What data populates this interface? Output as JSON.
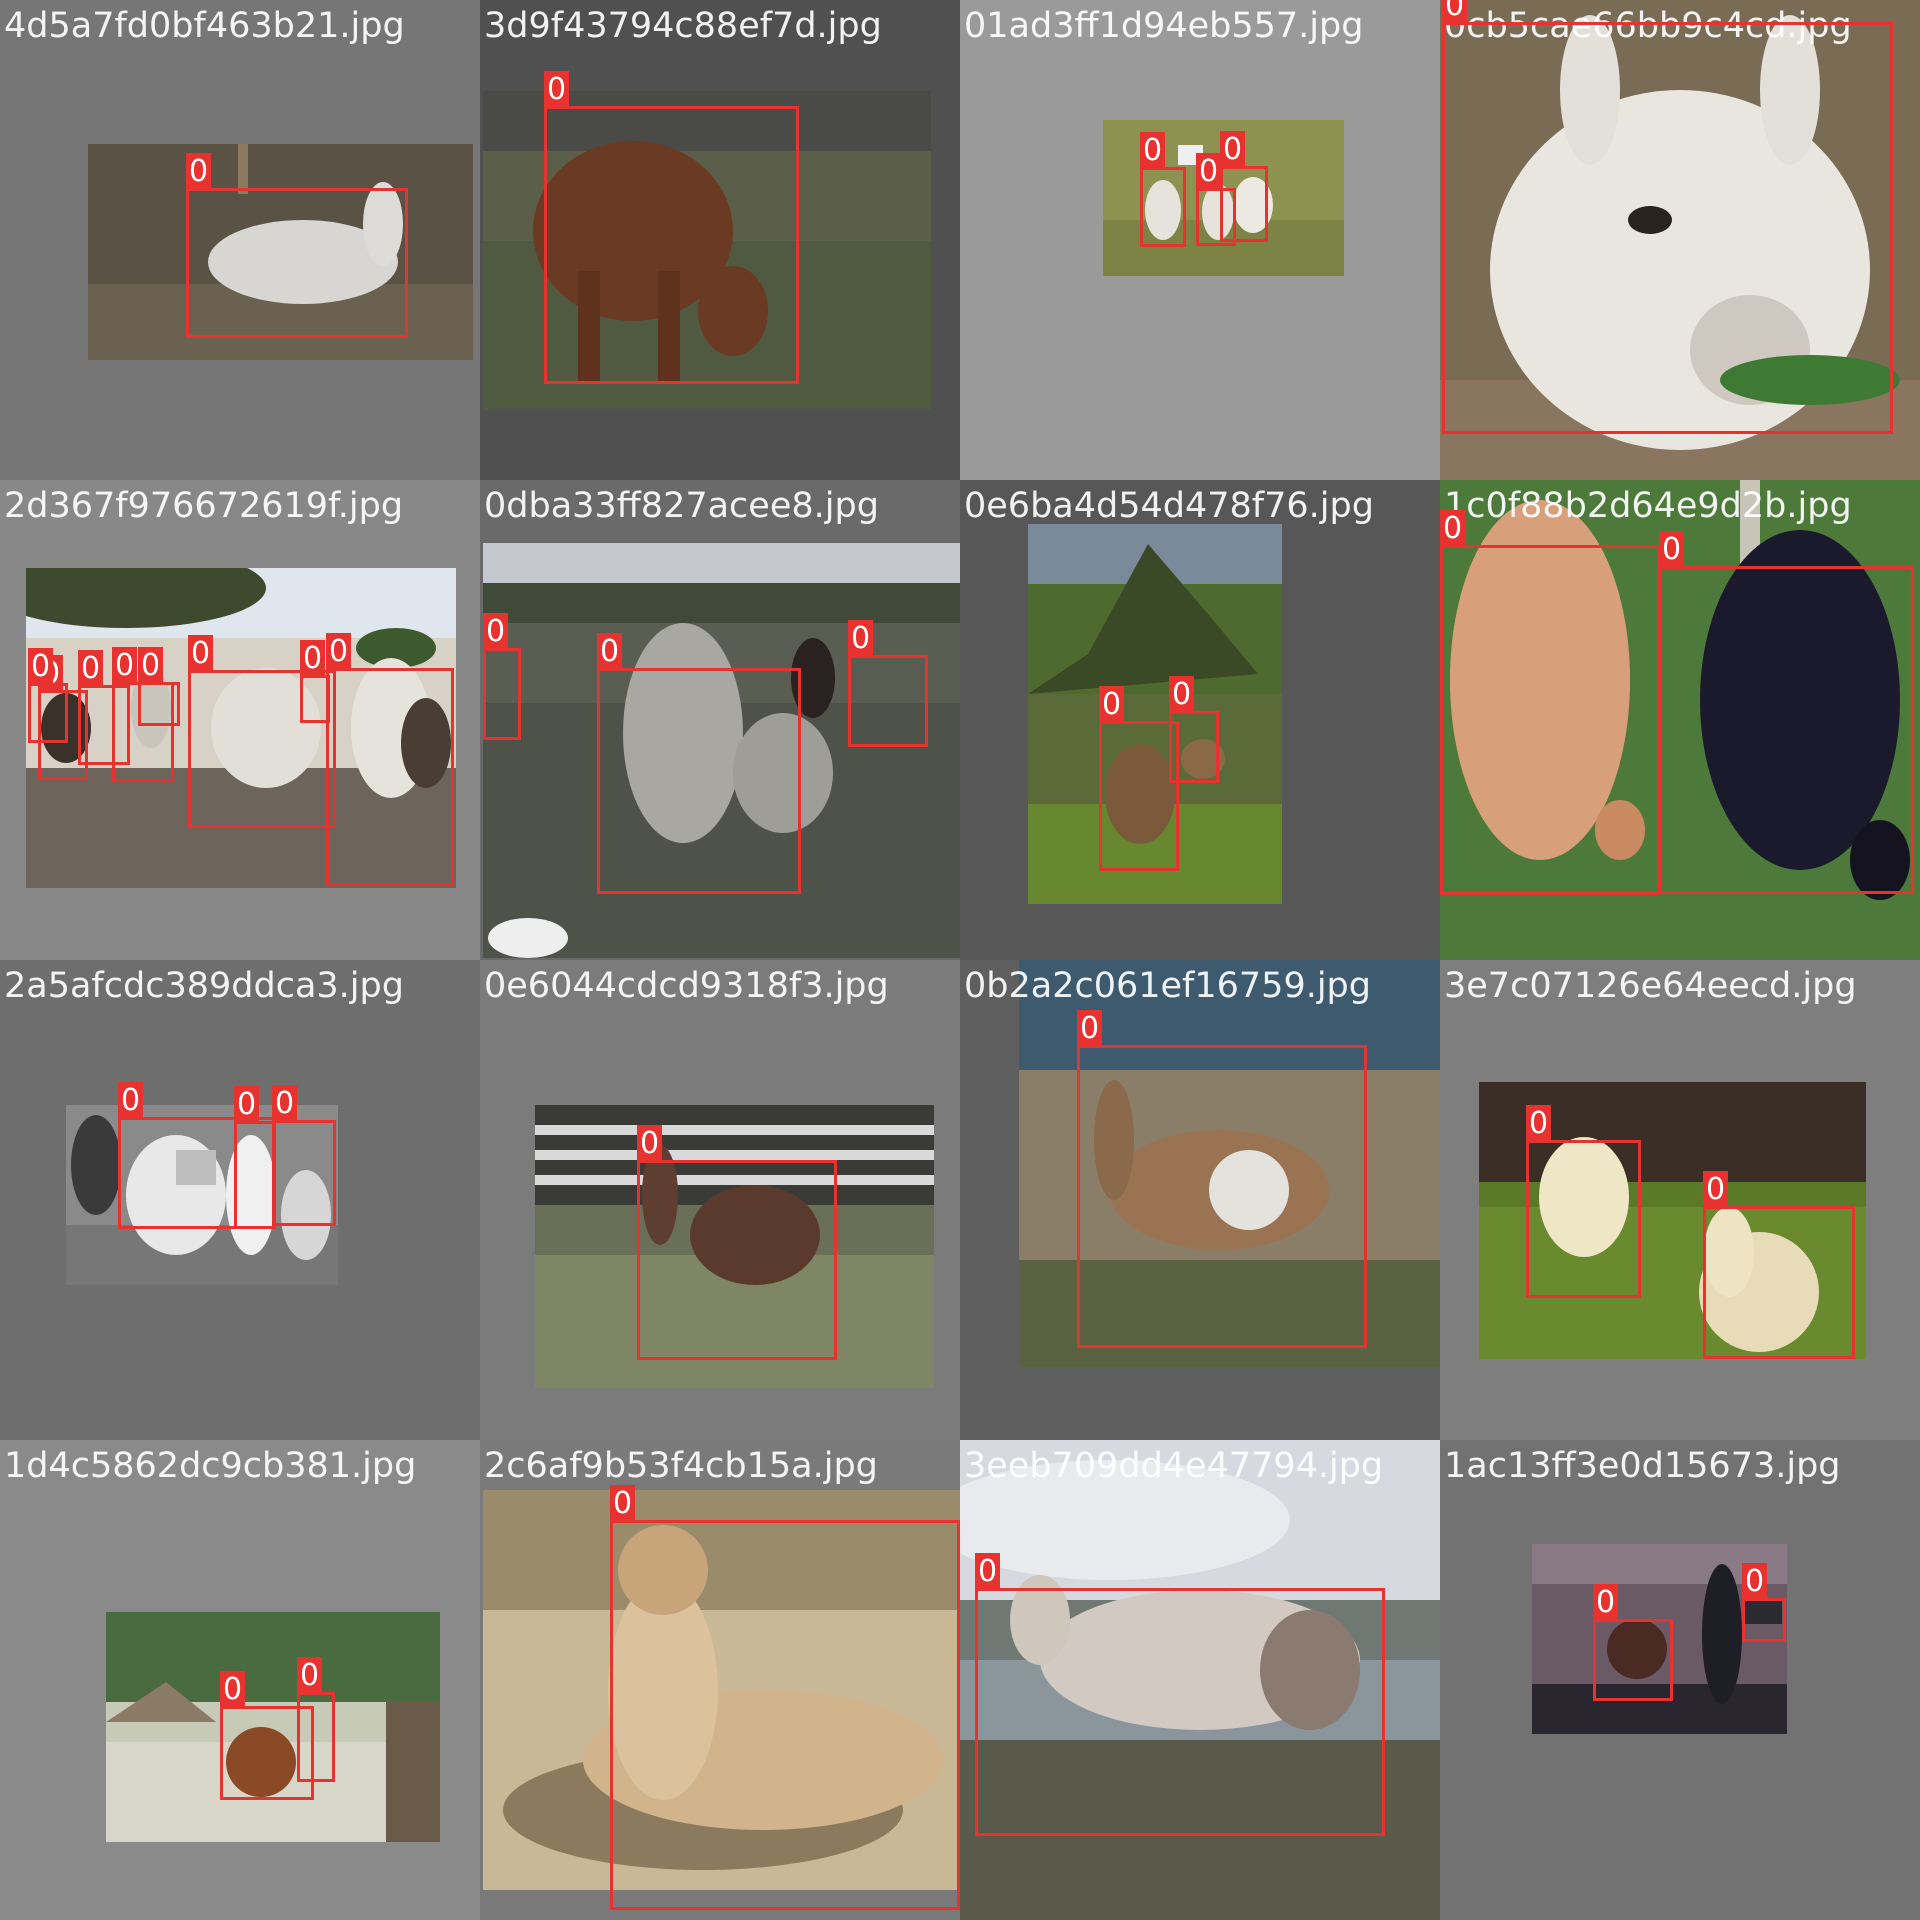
{
  "colors": {
    "box": "#e8322f",
    "label_text": "#ffffff"
  },
  "box_label": "0",
  "tiles": [
    {
      "filename": "4d5a7fd0bf463b21.jpg",
      "bg": "#767676"
    },
    {
      "filename": "3d9f43794c88ef7d.jpg",
      "bg": "#505050"
    },
    {
      "filename": "01ad3ff1d94eb557.jpg",
      "bg": "#9a9a9a"
    },
    {
      "filename": "0cb5cae66bb9c4cd.jpg",
      "bg": "#7a7a7a"
    },
    {
      "filename": "2d367f976672619f.jpg",
      "bg": "#888888"
    },
    {
      "filename": "0dba33ff827acee8.jpg",
      "bg": "#6a6a6a"
    },
    {
      "filename": "0e6ba4d54d478f76.jpg",
      "bg": "#575757"
    },
    {
      "filename": "1c0f88b2d64e9d2b.jpg",
      "bg": "#7a7a7a"
    },
    {
      "filename": "2a5afcdc389ddca3.jpg",
      "bg": "#6e6e6e"
    },
    {
      "filename": "0e6044cdcd9318f3.jpg",
      "bg": "#7b7b7b"
    },
    {
      "filename": "0b2a2c061ef16759.jpg",
      "bg": "#5f5f5f"
    },
    {
      "filename": "3e7c07126e64eecd.jpg",
      "bg": "#7e7e7e"
    },
    {
      "filename": "1d4c5862dc9cb381.jpg",
      "bg": "#8a8a8a"
    },
    {
      "filename": "2c6af9b53f4cb15a.jpg",
      "bg": "#7a7a7a"
    },
    {
      "filename": "3eeb709dd4e47794.jpg",
      "bg": "#cfd4da"
    },
    {
      "filename": "1ac13ff3e0d15673.jpg",
      "bg": "#727272"
    }
  ]
}
